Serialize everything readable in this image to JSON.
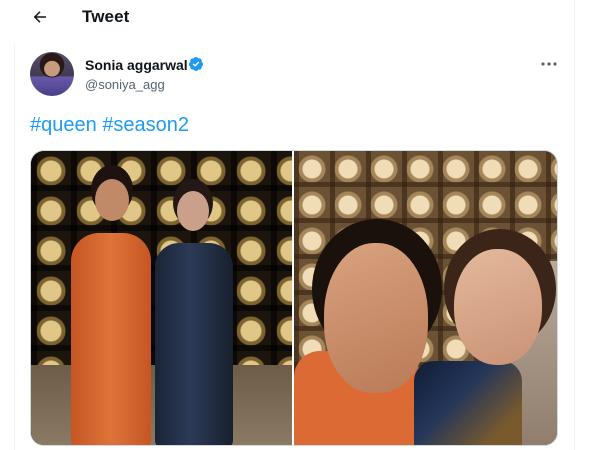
{
  "header": {
    "title": "Tweet",
    "back_icon": "arrow-left-icon"
  },
  "tweet": {
    "author": {
      "display_name": "Sonia aggarwal",
      "handle": "@soniya_agg",
      "verified": true,
      "verified_color": "#1d9bf0"
    },
    "hashtags": [
      "#queen",
      "#season2"
    ],
    "hashtag_color": "#1d9bf0",
    "media": [
      {
        "kind": "photo",
        "description_icon": "photo-two-women-lattice-icon"
      },
      {
        "kind": "photo",
        "description_icon": "photo-selfie-icon"
      }
    ]
  },
  "more_icon": "more-dots-icon"
}
